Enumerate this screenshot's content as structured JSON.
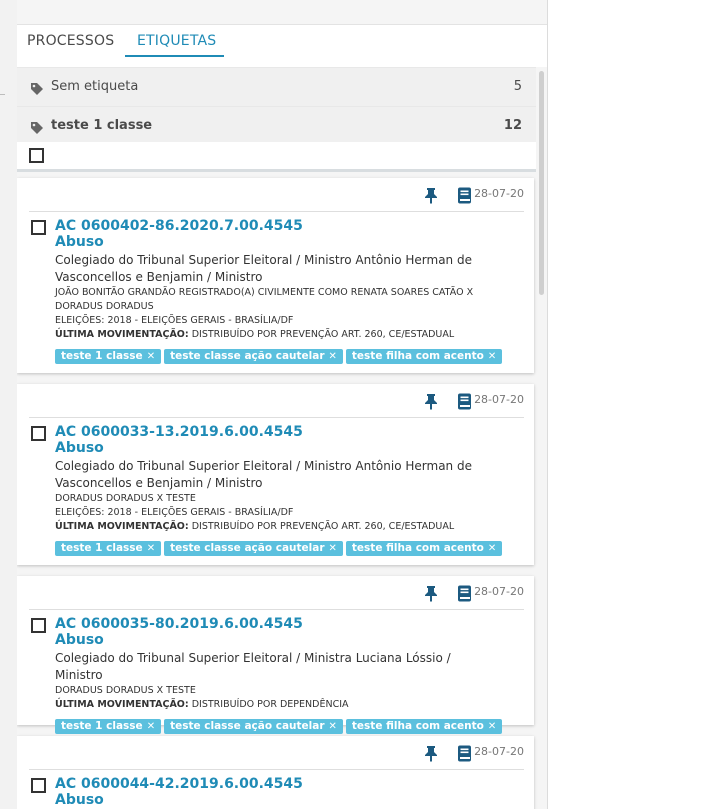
{
  "tabs": [
    {
      "label": "PROCESSOS"
    },
    {
      "label": "ETIQUETAS"
    }
  ],
  "groups": [
    {
      "label": "Sem etiqueta",
      "count": "5"
    },
    {
      "label": "teste 1 classe",
      "count": "12"
    }
  ],
  "cards": [
    {
      "date": "28-07-20",
      "number": "AC 0600402-86.2020.7.00.4545",
      "class": "Abuso",
      "organ": "Colegiado do Tribunal Superior Eleitoral / Ministro Antônio Herman de Vasconcellos e Benjamin / Ministro",
      "parties": "JOÃO BONITÃO GRANDÃO REGISTRADO(A) CIVILMENTE COMO RENATA SOARES CATÃO X DORADUS DORADUS",
      "election": "ELEIÇÕES: 2018 - ELEIÇÕES GERAIS - BRASÍLIA/DF",
      "movement_label": "ÚLTIMA MOVIMENTAÇÃO:",
      "movement": "DISTRIBUÍDO POR PREVENÇÃO ART. 260, CE/ESTADUAL",
      "tags": [
        "teste 1 classe",
        "teste classe ação cautelar",
        "teste filha com acento"
      ]
    },
    {
      "date": "28-07-20",
      "number": "AC 0600033-13.2019.6.00.4545",
      "class": "Abuso",
      "organ": "Colegiado do Tribunal Superior Eleitoral / Ministro Antônio Herman de Vasconcellos e Benjamin / Ministro",
      "parties": "DORADUS DORADUS X TESTE",
      "election": "ELEIÇÕES: 2018 - ELEIÇÕES GERAIS - BRASÍLIA/DF",
      "movement_label": "ÚLTIMA MOVIMENTAÇÃO:",
      "movement": "DISTRIBUÍDO POR PREVENÇÃO ART. 260, CE/ESTADUAL",
      "tags": [
        "teste 1 classe",
        "teste classe ação cautelar",
        "teste filha com acento"
      ]
    },
    {
      "date": "28-07-20",
      "number": "AC 0600035-80.2019.6.00.4545",
      "class": "Abuso",
      "organ": "Colegiado do Tribunal Superior Eleitoral / Ministra Luciana Lóssio / Ministro",
      "parties": "DORADUS DORADUS X TESTE",
      "movement_label": "ÚLTIMA MOVIMENTAÇÃO:",
      "movement": "DISTRIBUÍDO POR DEPENDÊNCIA",
      "tags": [
        "teste 1 classe",
        "teste classe ação cautelar",
        "teste filha com acento"
      ]
    },
    {
      "date": "28-07-20",
      "number": "AC 0600044-42.2019.6.00.4545",
      "class": "Abuso"
    }
  ],
  "colors": {
    "accent": "#1f8bb6",
    "chip": "#5bc0de"
  },
  "icons": {
    "group": "tag-icon",
    "pin": "pin-icon",
    "doc": "book-icon",
    "remove": "close-icon"
  }
}
